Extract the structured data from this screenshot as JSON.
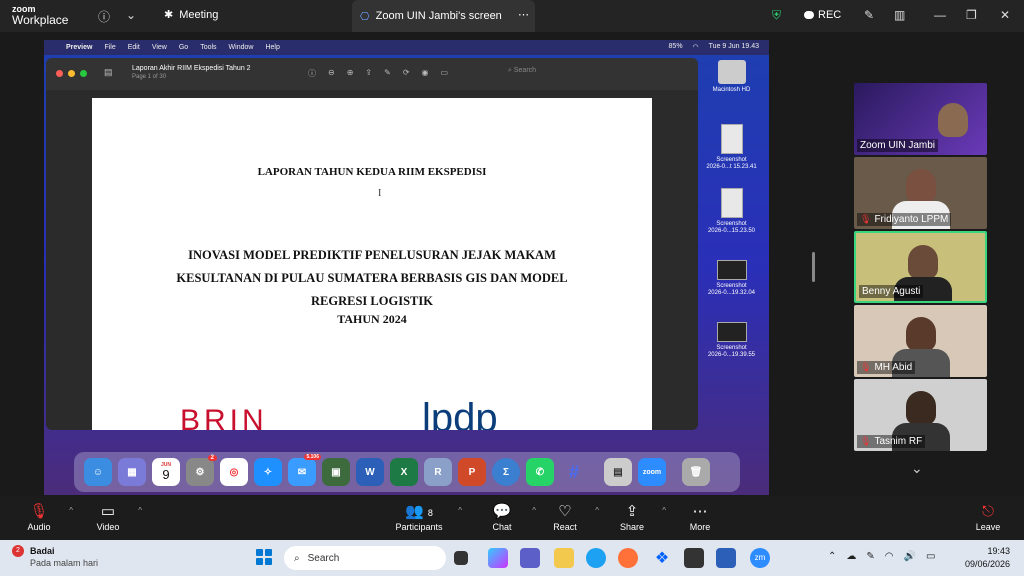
{
  "zoom": {
    "logo_line1": "zoom",
    "logo_line2": "Workplace",
    "meeting_tab": "Meeting",
    "screen_tab": "Zoom UIN Jambi's screen",
    "rec_label": "REC"
  },
  "mac": {
    "menu": [
      "Preview",
      "File",
      "Edit",
      "View",
      "Go",
      "Tools",
      "Window",
      "Help"
    ],
    "battery": "85%",
    "datetime": "Tue 9 Jun  19.43"
  },
  "preview": {
    "title": "Laporan Akhir  RIIM Ekspedisi Tahun 2",
    "page_info": "Page 1 of 30",
    "search_placeholder": "Search"
  },
  "document": {
    "heading": "LAPORAN TAHUN KEDUA RIIM EKSPEDISI",
    "title_lines": [
      "INOVASI MODEL PREDIKTIF PENELUSURAN JEJAK MAKAM",
      "KESULTANAN DI PULAU SUMATERA BERBASIS GIS DAN MODEL",
      "REGRESI LOGISTIK"
    ],
    "year": "TAHUN 2024",
    "logo_left": "BRIN",
    "logo_right": "lpdp"
  },
  "desktop": {
    "items": [
      {
        "line1": "Macintosh HD",
        "line2": ""
      },
      {
        "line1": "Screenshot",
        "line2": "2026-0...t 15.23.41"
      },
      {
        "line1": "Screenshot",
        "line2": "2026-0...15.23.50"
      },
      {
        "line1": "Screenshot",
        "line2": "2026-0...19.32.04"
      },
      {
        "line1": "Screenshot",
        "line2": "2026-0...19.39.55"
      }
    ],
    "calendar_month": "JUN",
    "calendar_day": "9",
    "mail_badge": "5.106",
    "settings_badge": "2"
  },
  "participants": [
    {
      "name": "Zoom UIN Jambi",
      "muted": false
    },
    {
      "name": "Fridiyanto LPPM",
      "muted": true
    },
    {
      "name": "Benny Agusti",
      "muted": false
    },
    {
      "name": "MH Abid",
      "muted": true
    },
    {
      "name": "Tasnim RF",
      "muted": true
    }
  ],
  "controls": {
    "audio": "Audio",
    "video": "Video",
    "participants": "Participants",
    "participants_count": "8",
    "chat": "Chat",
    "react": "React",
    "share": "Share",
    "more": "More",
    "leave": "Leave"
  },
  "taskbar": {
    "weather_title": "Badai",
    "weather_sub": "Pada malam hari",
    "weather_badge": "2",
    "search_placeholder": "Search",
    "time": "19:43",
    "date": "09/06/2026"
  }
}
